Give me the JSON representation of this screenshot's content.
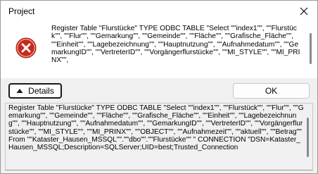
{
  "window": {
    "title": "Project",
    "close_icon": "close-icon"
  },
  "message": {
    "icon": "error-icon",
    "text": "Register Table \"Flurstücke\" TYPE ODBC TABLE \"Select \"\"index1\"\", \"\"Flurstück\"\", \"\"Flur\"\", \"\"Gemarkung\"\", \"\"Gemeinde\"\", \"\"Fläche\"\", \"\"Grafische_Fläche\"\", \"\"Einheit\"\", \"\"Lagebezeichnung\"\", \"\"Hauptnutzung\"\", \"\"Aufnahmedatum\"\", \"\"GemarkungID\"\", \"\"VertreterID\"\", \"\"Vorgängerflurstücke\"\", \"\"MI_STYLE\"\", \"\"MI_PRINX\"\","
  },
  "buttons": {
    "details_label": "Details",
    "ok_label": "OK"
  },
  "details": {
    "text": "Register Table \"Flurstücke\" TYPE ODBC TABLE \"Select \"\"index1\"\", \"\"Flurstück\"\", \"\"Flur\"\", \"\"Gemarkung\"\", \"\"Gemeinde\"\", \"\"Fläche\"\", \"\"Grafische_Fläche\"\", \"\"Einheit\"\", \"\"Lagebezeichnung\"\", \"\"Hauptnutzung\"\", \"\"Aufnahmedatum\"\", \"\"GemarkungID\"\", \"\"VertreterID\"\", \"\"Vorgängerflurstücke\"\", \"\"MI_STYLE\"\", \"\"MI_PRINX\"\", \"\"OBJECT\"\", \"\"Aufnahmezeit\"\", \"\"aktuell\"\", \"\"Betrag\"\" From \"\"Kataster_Hausen_MSSQL\"\".\"\"dbo\"\".\"\"Flurstücke\"\" \" CONNECTION \"DSN=Kataster_Hausen_MSSQL;Description=SQLServer;UID=best;Trusted_Connection"
  },
  "colors": {
    "error_red": "#c42b1c",
    "dialog_bg": "#f0f0f0",
    "panel_bg": "#ffffff"
  }
}
